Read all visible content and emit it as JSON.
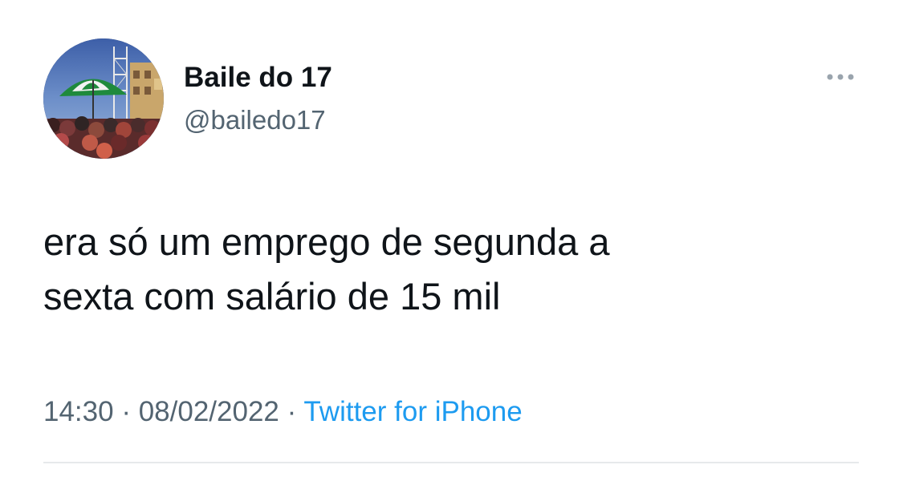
{
  "tweet": {
    "author": {
      "display_name": "Baile do 17",
      "handle": "@bailedo17"
    },
    "text_lines": [
      "era só um emprego de segunda a",
      "sexta com salário de 15 mil"
    ],
    "time": "14:30",
    "separator": " · ",
    "date": "08/02/2022",
    "source": "Twitter for iPhone"
  },
  "icons": {
    "more": "more-horizontal-icon",
    "avatar": "profile-photo"
  },
  "colors": {
    "text": "#0f1419",
    "secondary": "#536471",
    "link": "#1d9bf0",
    "divider": "#e6e9eb"
  }
}
